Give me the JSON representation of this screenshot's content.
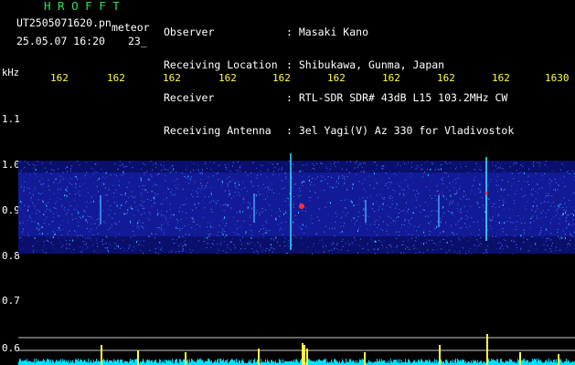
{
  "header": {
    "brand": "H R O F F T",
    "filename": "UT2505071620.pn",
    "tag": "meteor",
    "datetime": "25.05.07 16:20",
    "count": "23_"
  },
  "info": [
    {
      "label": "Observer",
      "value": ": Masaki Kano"
    },
    {
      "label": "Receiving Location",
      "value": ": Shibukawa, Gunma, Japan"
    },
    {
      "label": "Receiver",
      "value": ": RTL-SDR SDR# 43dB L15 103.2MHz CW"
    },
    {
      "label": "Receiving Antenna",
      "value": ": 3el Yagi(V) Az 330 for Vladivostok"
    }
  ],
  "axis": {
    "y_unit": "kHz",
    "y_ticks": [
      "1.1",
      "1.0",
      "0.9",
      "0.8",
      "0.7",
      "0.6"
    ],
    "x_ticks": [
      "162",
      "162",
      "162",
      "162",
      "162",
      "162",
      "162",
      "162",
      "162",
      "1630"
    ]
  },
  "colors": {
    "background": "#000000",
    "noise_band": "#1a22c8",
    "ticks": "#ffff40",
    "activity": "#00e0ff",
    "meteor_echo": "#ff3030"
  }
}
